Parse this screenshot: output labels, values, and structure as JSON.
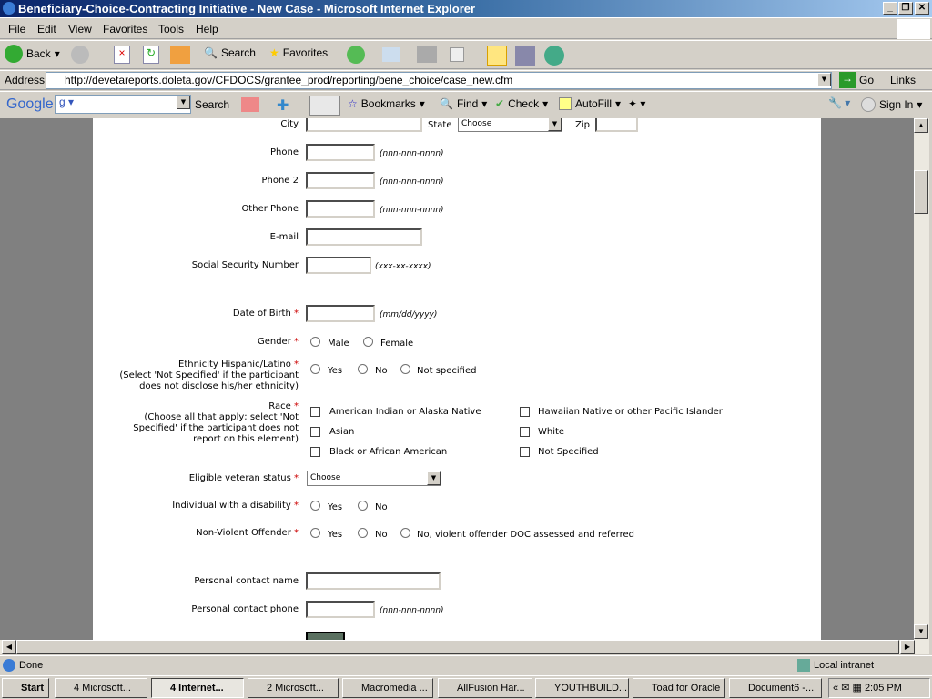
{
  "window": {
    "title": "Beneficiary-Choice-Contracting Initiative - New Case - Microsoft Internet Explorer"
  },
  "menu": [
    "File",
    "Edit",
    "View",
    "Favorites",
    "Tools",
    "Help"
  ],
  "toolbar": {
    "back": "Back",
    "search": "Search",
    "favorites": "Favorites"
  },
  "address": {
    "label": "Address",
    "url": "http://devetareports.doleta.gov/CFDOCS/grantee_prod/reporting/bene_choice/case_new.cfm",
    "go": "Go",
    "links": "Links"
  },
  "google": {
    "logo": "Google",
    "search": "Search",
    "bookmarks": "Bookmarks",
    "find": "Find",
    "check": "Check",
    "autofill": "AutoFill",
    "signin": "Sign In"
  },
  "form": {
    "city": "City",
    "state": "State",
    "state_value": "Choose",
    "zip": "Zip",
    "phone": "Phone",
    "phone2": "Phone 2",
    "other_phone": "Other Phone",
    "phone_hint": "(nnn-nnn-nnnn)",
    "email": "E-mail",
    "ssn": "Social Security Number",
    "ssn_hint": "(xxx-xx-xxxx)",
    "dob": "Date of Birth",
    "dob_hint": "(mm/dd/yyyy)",
    "req": "*",
    "gender": "Gender",
    "male": "Male",
    "female": "Female",
    "ethnicity": "Ethnicity Hispanic/Latino",
    "ethnicity_note1": "(Select 'Not Specified' if the participant",
    "ethnicity_note2": "does not disclose his/her ethnicity)",
    "yes": "Yes",
    "no": "No",
    "not_specified": "Not specified",
    "race": "Race",
    "race_note1": "(Choose all that apply; select 'Not",
    "race_note2": "Specified' if the participant does not",
    "race_note3": "report on this element)",
    "race_options": [
      "American Indian or Alaska Native",
      "Hawaiian Native or other Pacific Islander",
      "Asian",
      "White",
      "Black or African American",
      "Not Specified"
    ],
    "veteran": "Eligible veteran status",
    "veteran_value": "Choose",
    "disability": "Individual with a disability",
    "offender": "Non-Violent Offender",
    "offender_other": "No, violent offender DOC assessed and referred",
    "contact_name": "Personal contact name",
    "contact_phone": "Personal contact phone"
  },
  "status": {
    "text": "Done",
    "zone": "Local intranet"
  },
  "taskbar": {
    "start": "Start",
    "items": [
      "4 Microsoft...",
      "4 Internet...",
      "2 Microsoft...",
      "Macromedia ...",
      "AllFusion Har...",
      "YOUTHBUILD...",
      "Toad for Oracle",
      "Document6 -..."
    ],
    "clock": "2:05 PM"
  }
}
